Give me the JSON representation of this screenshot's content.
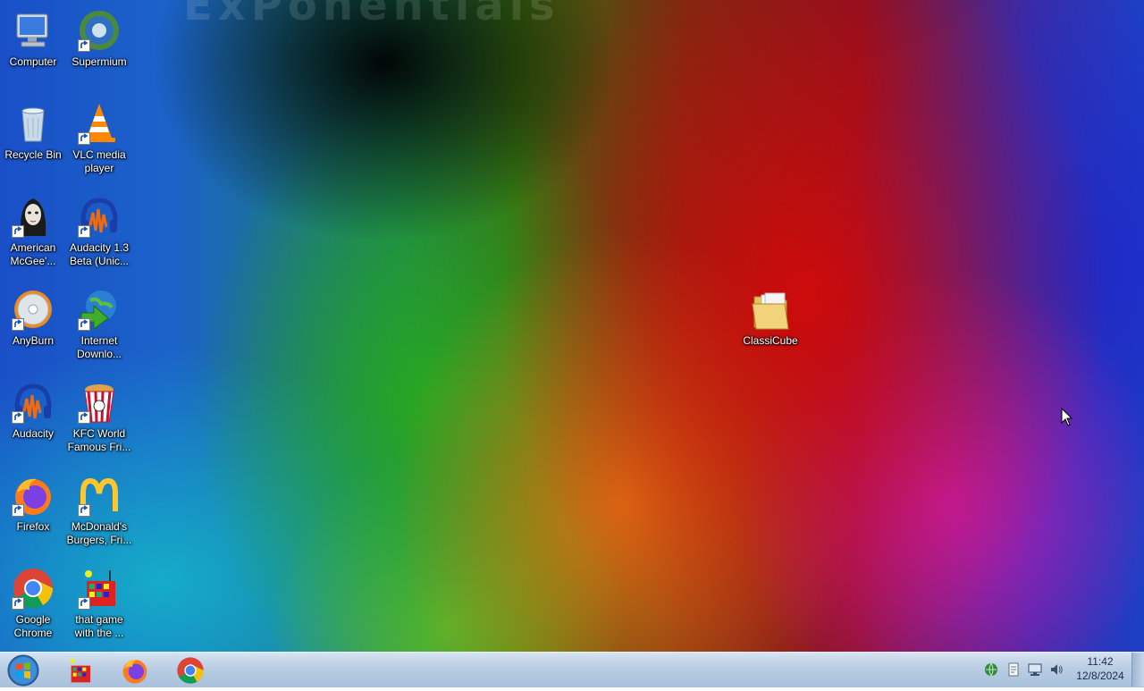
{
  "desktop": {
    "watermark": "ExPonentials",
    "icons": [
      {
        "label": "Computer"
      },
      {
        "label": "Supermium"
      },
      {
        "label": "Recycle Bin"
      },
      {
        "label": "VLC media player"
      },
      {
        "label": "American McGee'..."
      },
      {
        "label": "Audacity 1.3 Beta (Unic..."
      },
      {
        "label": "AnyBurn"
      },
      {
        "label": "Internet Downlo..."
      },
      {
        "label": "Audacity"
      },
      {
        "label": "KFC  World Famous Fri..."
      },
      {
        "label": "Firefox"
      },
      {
        "label": "McDonald's Burgers, Fri..."
      },
      {
        "label": "Google Chrome"
      },
      {
        "label": "that game with the ..."
      },
      {
        "label": "ClassiCube"
      }
    ]
  },
  "taskbar": {
    "clock": {
      "time": "11:42",
      "date": "12/8/2024"
    },
    "pinned": [
      {
        "icon": "game-icon"
      },
      {
        "icon": "firefox-icon"
      },
      {
        "icon": "chrome-icon"
      }
    ],
    "tray": [
      "network-globe-icon",
      "notes-icon",
      "display-icon",
      "volume-icon"
    ]
  },
  "colors": {
    "taskbar": "#b9cde3",
    "label": "#ffffff"
  }
}
